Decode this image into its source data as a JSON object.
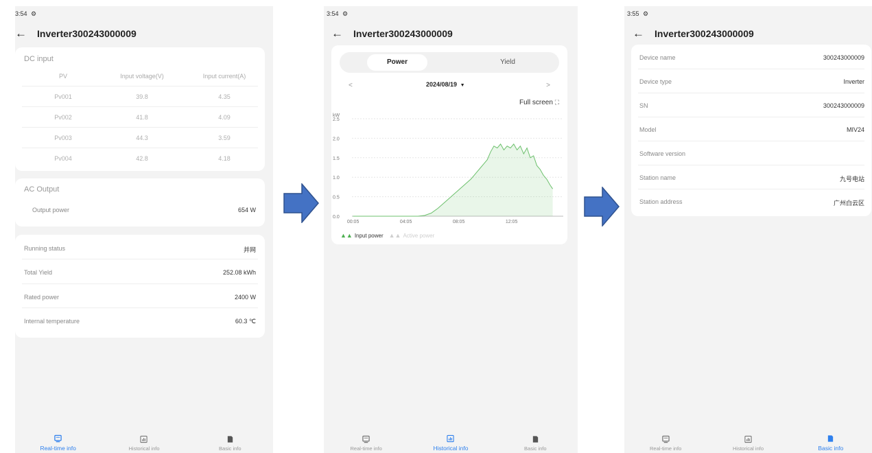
{
  "common": {
    "status_icon": "settings-icon",
    "back_icon": "arrow-left-icon",
    "title": "Inverter300243000009"
  },
  "screen1": {
    "time": "3:54",
    "dc": {
      "title": "DC input",
      "headers": [
        "PV",
        "Input voltage(V)",
        "Input current(A)"
      ],
      "rows": [
        [
          "Pv001",
          "39.8",
          "4.35"
        ],
        [
          "Pv002",
          "41.8",
          "4.09"
        ],
        [
          "Pv003",
          "44.3",
          "3.59"
        ],
        [
          "Pv004",
          "42.8",
          "4.18"
        ]
      ]
    },
    "ac": {
      "title": "AC Output",
      "label": "Output power",
      "value": "654 W"
    },
    "info": [
      {
        "label": "Running status",
        "value": "并网"
      },
      {
        "label": "Total Yield",
        "value": "252.08 kWh"
      },
      {
        "label": "Rated power",
        "value": "2400 W"
      },
      {
        "label": "Internal temperature",
        "value": "60.3 ℃"
      }
    ]
  },
  "screen2": {
    "time": "3:54",
    "tabs": {
      "power": "Power",
      "yield": "Yield"
    },
    "prev": "<",
    "next": ">",
    "date": "2024/08/19",
    "date_caret": "▼",
    "fullscreen": "Full screen",
    "fullscreen_icon": "⛶",
    "legend": {
      "input": "Input power",
      "active": "Active power"
    }
  },
  "chart_data": {
    "type": "area",
    "ylabel": "kW",
    "ylim": [
      0,
      2.5
    ],
    "yticks": [
      "2.5",
      "2.0",
      "1.5",
      "1.0",
      "0.5",
      "0.0"
    ],
    "xticks": [
      "00:05",
      "04:05",
      "08:05",
      "12:05"
    ],
    "x_hours": [
      0.08,
      1,
      2,
      3,
      4,
      5,
      5.5,
      6,
      6.5,
      7,
      7.5,
      8,
      8.5,
      9,
      9.25,
      9.5,
      9.75,
      10,
      10.25,
      10.5,
      10.75,
      11,
      11.25,
      11.5,
      11.75,
      12,
      12.25,
      12.5,
      12.75,
      13,
      13.25,
      13.5,
      13.75,
      14,
      14.25,
      14.5,
      14.75,
      15,
      15.2
    ],
    "series": [
      {
        "name": "Input power",
        "color": "#6cc06c",
        "values": [
          0,
          0,
          0,
          0,
          0,
          0,
          0.02,
          0.08,
          0.2,
          0.35,
          0.5,
          0.65,
          0.8,
          0.95,
          1.05,
          1.15,
          1.25,
          1.35,
          1.45,
          1.65,
          1.8,
          1.75,
          1.85,
          1.7,
          1.8,
          1.75,
          1.85,
          1.7,
          1.8,
          1.6,
          1.75,
          1.5,
          1.55,
          1.3,
          1.2,
          1.05,
          0.95,
          0.8,
          0.7
        ]
      },
      {
        "name": "Active power",
        "color": "#d0d0d0",
        "values": []
      }
    ]
  },
  "screen3": {
    "time": "3:55",
    "rows": [
      {
        "label": "Device name",
        "value": "300243000009"
      },
      {
        "label": "Device type",
        "value": "Inverter"
      },
      {
        "label": "SN",
        "value": "300243000009"
      },
      {
        "label": "Model",
        "value": "MIV24"
      },
      {
        "label": "Software version",
        "value": ""
      },
      {
        "label": "Station name",
        "value": "九号电站"
      },
      {
        "label": "Station address",
        "value": "广州白云区"
      }
    ]
  },
  "tabbar": {
    "realtime": "Real-time info",
    "historical": "Historical info",
    "basic": "Basic info"
  },
  "colors": {
    "accent": "#2f80ed",
    "arrow_fill": "#4472c4",
    "arrow_stroke": "#2f528f"
  }
}
